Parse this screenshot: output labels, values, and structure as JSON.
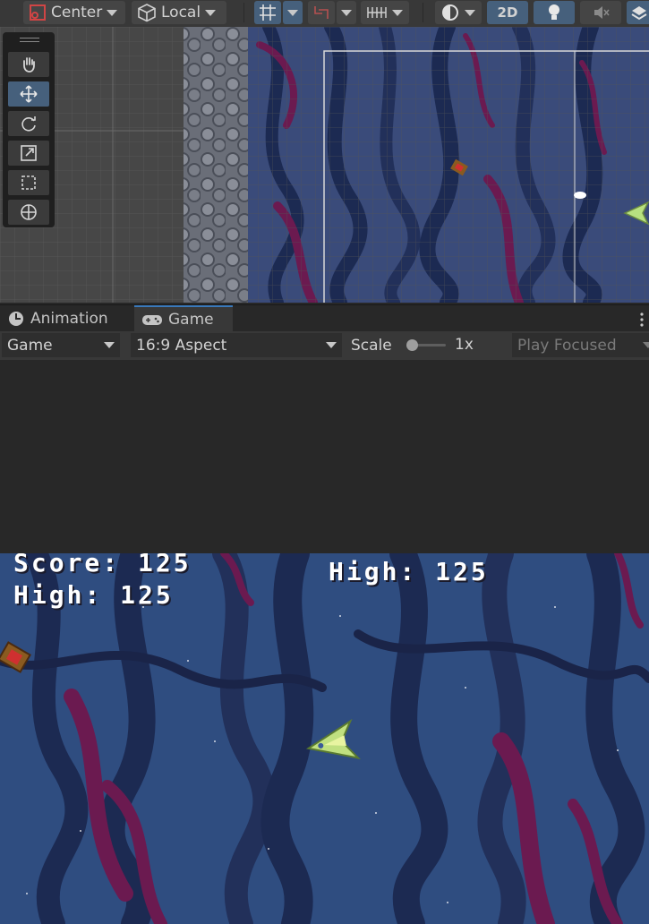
{
  "scene_toolbar": {
    "pivot_label": "Center",
    "space_label": "Local",
    "mode_2d_label": "2D"
  },
  "scene_tools": [
    "hand-tool",
    "move-tool",
    "rotate-tool",
    "scale-tool",
    "rect-tool",
    "transform-tool"
  ],
  "tabs": [
    {
      "label": "Animation",
      "icon": "clock-icon",
      "active": false
    },
    {
      "label": "Game",
      "icon": "gamepad-icon",
      "active": true
    }
  ],
  "game_toolbar": {
    "display": "Game",
    "aspect": "16:9 Aspect",
    "scale_label": "Scale",
    "scale_value": "1x",
    "play_mode": "Play Focused"
  },
  "game_hud": {
    "score_line": "Score: 125",
    "high_line_left": "High: 125",
    "high_line_center": "High: 125"
  },
  "colors": {
    "editor_bg": "#282828",
    "toolbar_bg": "#383838",
    "active_blue": "#46607c",
    "game_bg": "#2f4d80",
    "tentacle_dark": "#1c2a52",
    "tentacle_magenta": "#6b1a50"
  }
}
